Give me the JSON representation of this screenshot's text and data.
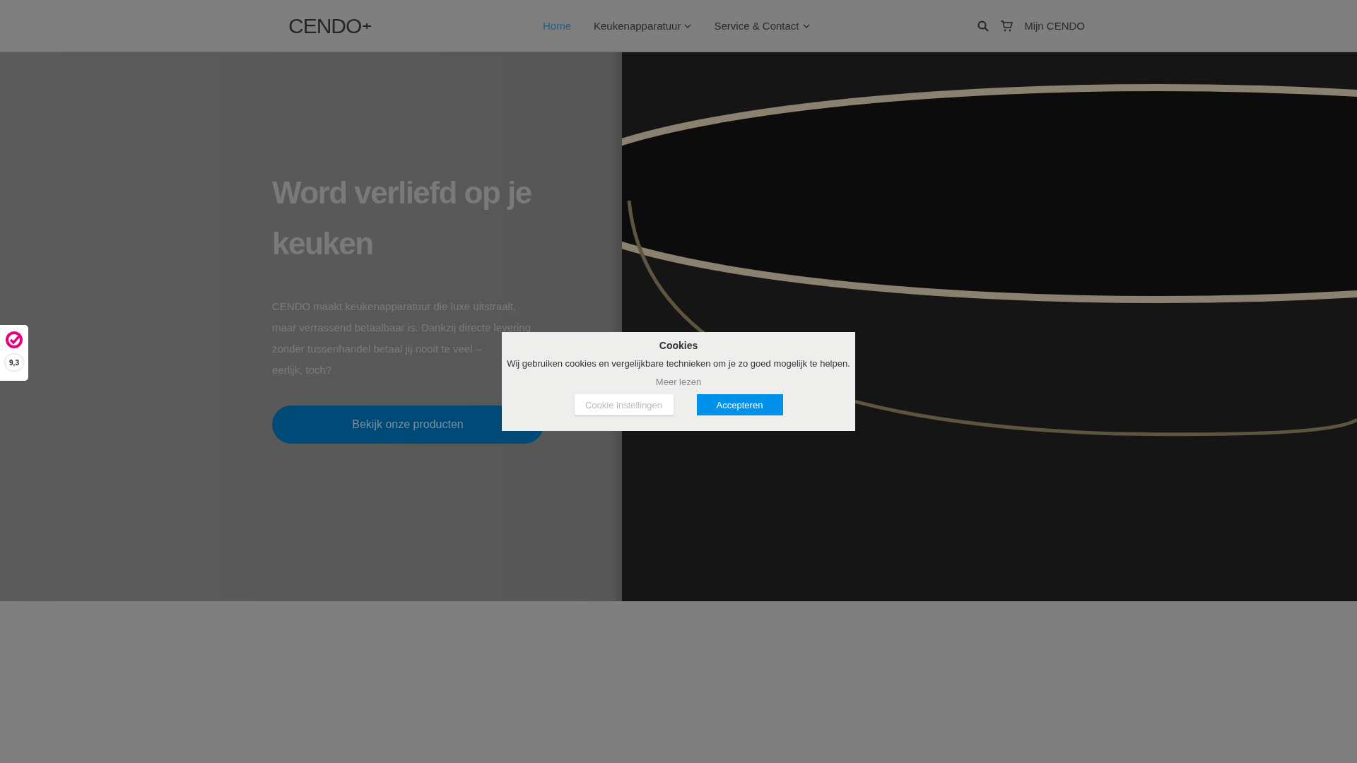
{
  "header": {
    "logo": "CENDO",
    "nav": [
      {
        "label": "Home",
        "selected": true,
        "dropdown": false
      },
      {
        "label": "Keukenapparatuur",
        "selected": false,
        "dropdown": true
      },
      {
        "label": "Service & Contact",
        "selected": false,
        "dropdown": true
      }
    ],
    "account": "Mijn CENDO"
  },
  "hero": {
    "title": "Word verliefd op je keuken",
    "text_lines": [
      "CENDO maakt keukenapparatuur die luxe uitstraalt,",
      "maar verrassend betaalbaar is. Dankzij directe levering",
      "zonder tussenhandel betaal jij nooit te veel –",
      "eerlijk, toch?"
    ],
    "button": "Bekijk onze producten"
  },
  "rating_widget": {
    "score": "9,3"
  },
  "cookie_dialog": {
    "title": "Cookies",
    "text": "Wij gebruiken cookies en vergelijkbare technieken om je zo goed mogelijk te helpen.",
    "link": "Meer lezen",
    "buttons": [
      {
        "label": "Cookie instellingen",
        "kind": "secondary"
      },
      {
        "label": "Accepteren",
        "kind": "primary"
      }
    ]
  }
}
